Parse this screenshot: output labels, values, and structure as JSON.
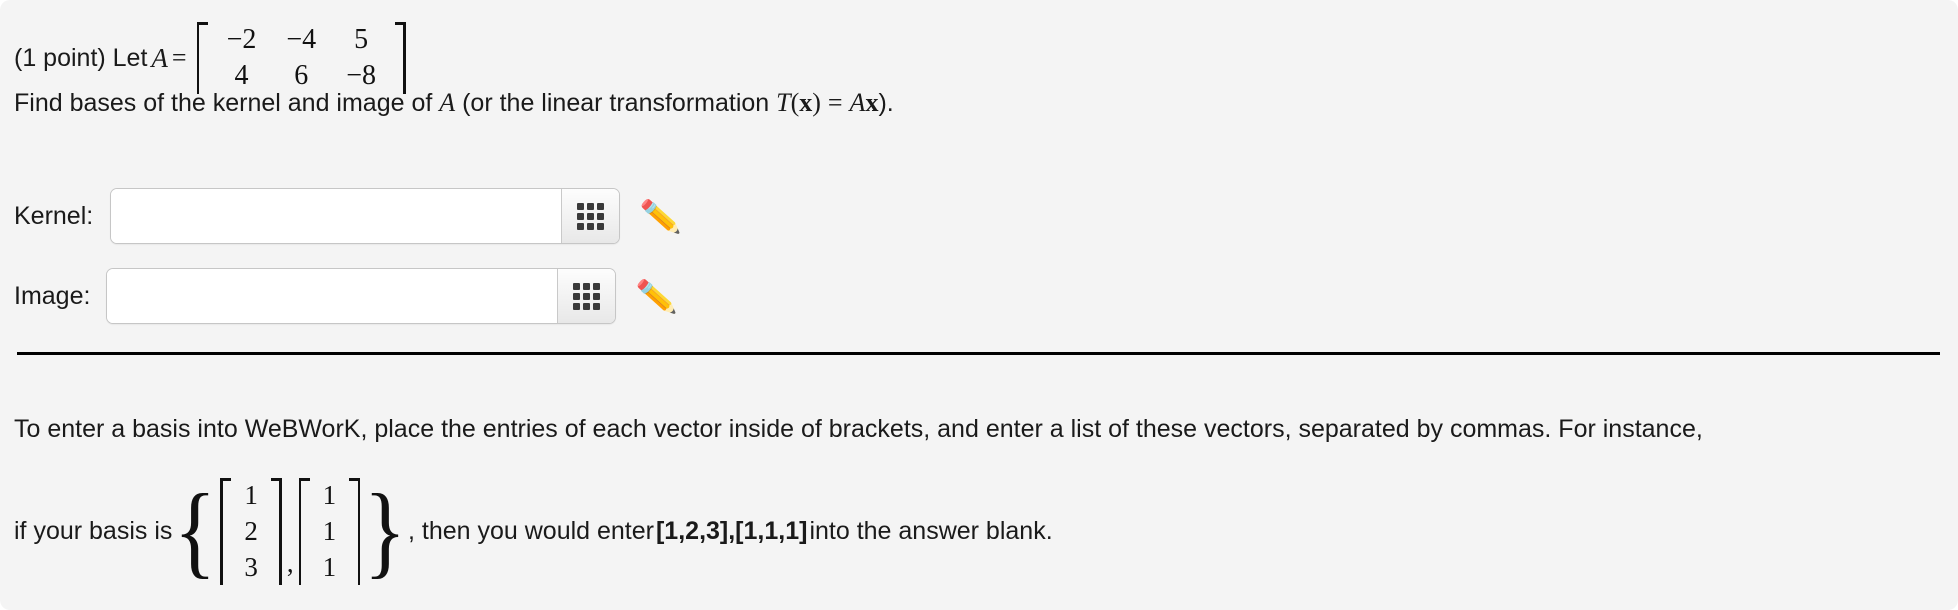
{
  "problem": {
    "points_label": "(1 point) Let",
    "matrix_var": "A",
    "equals": "=",
    "matrix": {
      "rows": [
        [
          "−2",
          "−4",
          "5"
        ],
        [
          "4",
          "6",
          "−8"
        ]
      ]
    },
    "instruction_line": {
      "part1": "Find bases of the kernel and image of",
      "var": "A",
      "part2": "(or the linear transformation",
      "t": "T",
      "open_paren": "(",
      "bold_x1": "x",
      "close_paren": ")",
      "eq": "=",
      "a": "A",
      "bold_x2": "x",
      "part3": ")."
    }
  },
  "answers": [
    {
      "label": "Kernel:",
      "value": "",
      "placeholder": "",
      "keypad_icon": "grid-keypad-icon",
      "pencil_icon": "✏️"
    },
    {
      "label": "Image:",
      "value": "",
      "placeholder": "",
      "keypad_icon": "grid-keypad-icon",
      "pencil_icon": "✏️"
    }
  ],
  "notes": {
    "line1": "To enter a basis into WeBWorK, place the entries of each vector inside of brackets, and enter a list of these vectors, separated by commas. For instance,",
    "line2_prefix": "if your basis is",
    "brace_open": "{",
    "vector1": [
      "1",
      "2",
      "3"
    ],
    "vector_separator": ",",
    "vector2": [
      "1",
      "1",
      "1"
    ],
    "brace_close": "}",
    "line2_middle": ", then you would enter",
    "example_answer": "[1,2,3],[1,1,1]",
    "line2_suffix": "into the answer blank."
  },
  "colors": {
    "panel_background": "#f4f4f4",
    "page_background": "#ffffff",
    "text": "#1a1a1a",
    "divider": "#000000",
    "input_border": "#c6c6c6",
    "keypad_dot": "#3a3a3a"
  }
}
